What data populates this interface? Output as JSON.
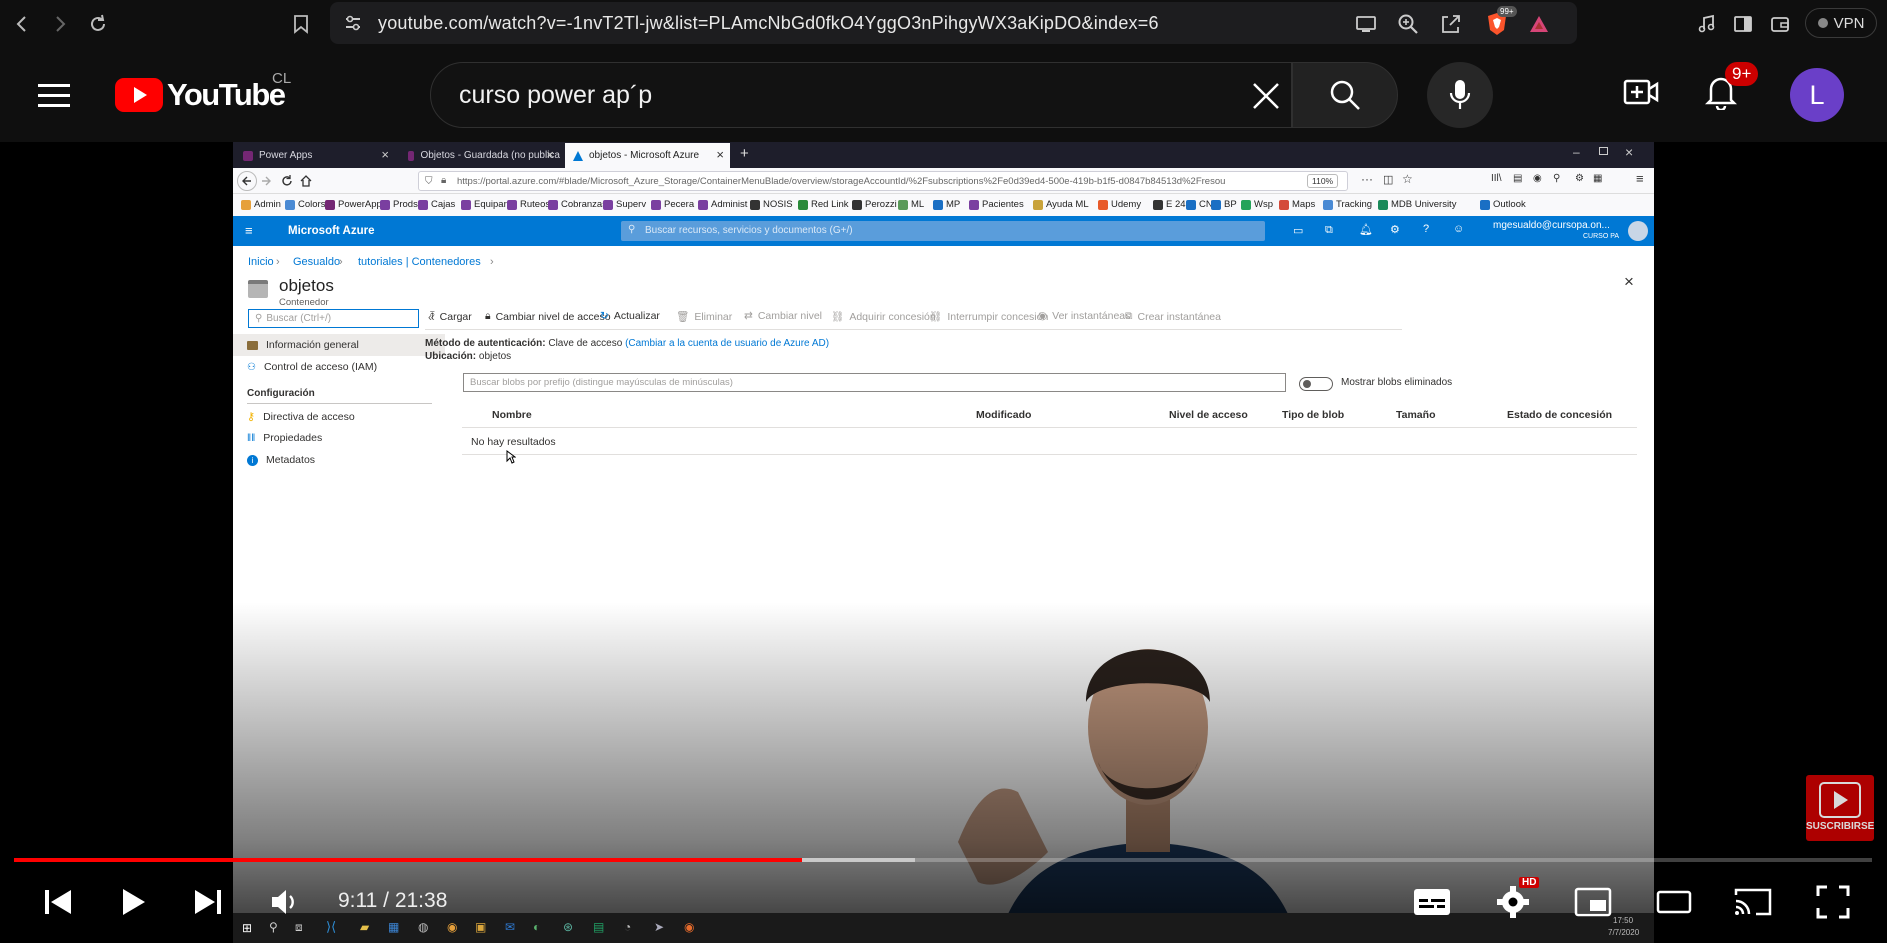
{
  "browser": {
    "url": "youtube.com/watch?v=-1nvT2Tl-jw&list=PLAmcNbGd0fkO4YggO3nPihgyWX3aKipDO&index=6",
    "extension_badge": "99+",
    "vpn_label": "VPN"
  },
  "youtube": {
    "logo_text": "YouTube",
    "country_code": "CL",
    "search_value": "curso power ap´p",
    "notification_count": "9+",
    "avatar_letter": "L",
    "colors": {
      "red": "#ff0000",
      "avatar": "#6a3fc8"
    }
  },
  "video": {
    "firefox": {
      "tabs": [
        {
          "label": "Power Apps"
        },
        {
          "label": "Objetos - Guardada (no publica"
        },
        {
          "label": "objetos - Microsoft Azure"
        }
      ],
      "url": "https://portal.azure.com/#blade/Microsoft_Azure_Storage/ContainerMenuBlade/overview/storageAccountId/%2Fsubscriptions%2Fe0d39ed4-500e-419b-b1f5-d0847b84513d%2Fresou",
      "zoom": "110%",
      "bookmarks": [
        "Admin",
        "Colors",
        "PowerApps",
        "Prods",
        "Cajas",
        "Equiparte",
        "Ruteos",
        "Cobranzas",
        "Superv",
        "Pecera",
        "Administ",
        "NOSIS",
        "Red Link",
        "Perozzi",
        "ML",
        "MP",
        "Pacientes",
        "Ayuda ML",
        "Udemy",
        "E 24",
        "CN",
        "BP",
        "Wsp",
        "Maps",
        "Tracking",
        "MDB University",
        "Outlook"
      ]
    },
    "azure": {
      "brand": "Microsoft Azure",
      "search_placeholder": "Buscar recursos, servicios y documentos (G+/)",
      "user_email": "mgesualdo@cursopa.on...",
      "user_tenant": "CURSO PA",
      "breadcrumb": [
        "Inicio",
        "Gesualdo",
        "tutoriales | Contenedores"
      ],
      "title": "objetos",
      "subtitle": "Contenedor",
      "side_search_placeholder": "Buscar (Ctrl+/)",
      "side_items": [
        "Información general",
        "Control de acceso (IAM)"
      ],
      "config_heading": "Configuración",
      "config_items": [
        "Directiva de acceso",
        "Propiedades",
        "Metadatos"
      ],
      "toolbar": [
        "Cargar",
        "Cambiar nivel de acceso",
        "Actualizar",
        "Eliminar",
        "Cambiar nivel",
        "Adquirir concesión",
        "Interrumpir concesión",
        "Ver instantáneas",
        "Crear instantánea"
      ],
      "auth_label": "Método de autenticación:",
      "auth_value": "Clave de acceso",
      "auth_link": "(Cambiar a la cuenta de usuario de Azure AD)",
      "location_label": "Ubicación:",
      "location_value": "objetos",
      "blob_search_placeholder": "Buscar blobs por prefijo (distingue mayúsculas de minúsculas)",
      "show_deleted_label": "Mostrar blobs eliminados",
      "columns": [
        "Nombre",
        "Modificado",
        "Nivel de acceso",
        "Tipo de blob",
        "Tamaño",
        "Estado de concesión"
      ],
      "empty_message": "No hay resultados",
      "colors": {
        "azure_blue": "#0078d4"
      }
    },
    "taskbar": {
      "time": "17:50",
      "date": "7/7/2020"
    },
    "subscribe_label": "SUSCRIBIRSE"
  },
  "player": {
    "current_time": "9:11",
    "duration": "21:38",
    "time_display": "9:11 / 21:38",
    "progress_fraction": 0.424,
    "buffered_fraction": 0.418,
    "quality_badge": "HD"
  }
}
